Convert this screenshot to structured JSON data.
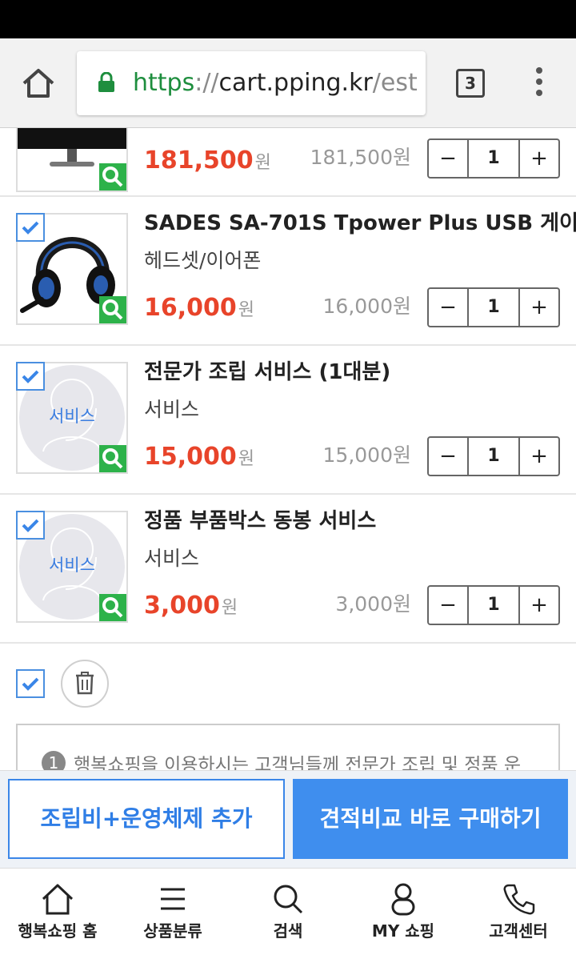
{
  "browser": {
    "url_scheme": "https",
    "url_sep": "://",
    "url_host": "cart.pping.kr",
    "url_path": "/est",
    "tab_count": "3"
  },
  "items": [
    {
      "name": "",
      "category": "",
      "price": "181,500",
      "currency": "원",
      "subtotal": "181,500원",
      "qty": "1",
      "checked": true
    },
    {
      "name": "SADES SA-701S Tpower Plus USB 게이...",
      "category": "헤드셋/이어폰",
      "price": "16,000",
      "currency": "원",
      "subtotal": "16,000원",
      "qty": "1",
      "checked": true
    },
    {
      "name": "전문가 조립 서비스 (1대분)",
      "category": "서비스",
      "price": "15,000",
      "currency": "원",
      "subtotal": "15,000원",
      "qty": "1",
      "service_label": "서비스",
      "checked": true
    },
    {
      "name": "정품 부품박스 동봉 서비스",
      "category": "서비스",
      "price": "3,000",
      "currency": "원",
      "subtotal": "3,000원",
      "qty": "1",
      "service_label": "서비스",
      "checked": true
    }
  ],
  "stepper": {
    "minus": "−",
    "plus": "+"
  },
  "notice": {
    "number": "1",
    "text": "행복쇼핑을 이용하시는 고객님들께 전문가 조립 및 정품 운"
  },
  "actions": {
    "assembly_label": "조립비+운영체제 추가",
    "buy_label": "견적비교 바로 구매하기"
  },
  "tabbar": {
    "home": "행복쇼핑 홈",
    "category": "상품분류",
    "search": "검색",
    "my": "MY 쇼핑",
    "support": "고객센터"
  },
  "colors": {
    "accent": "#3f8eee",
    "price": "#e8442a",
    "zoom": "#2db24a"
  }
}
